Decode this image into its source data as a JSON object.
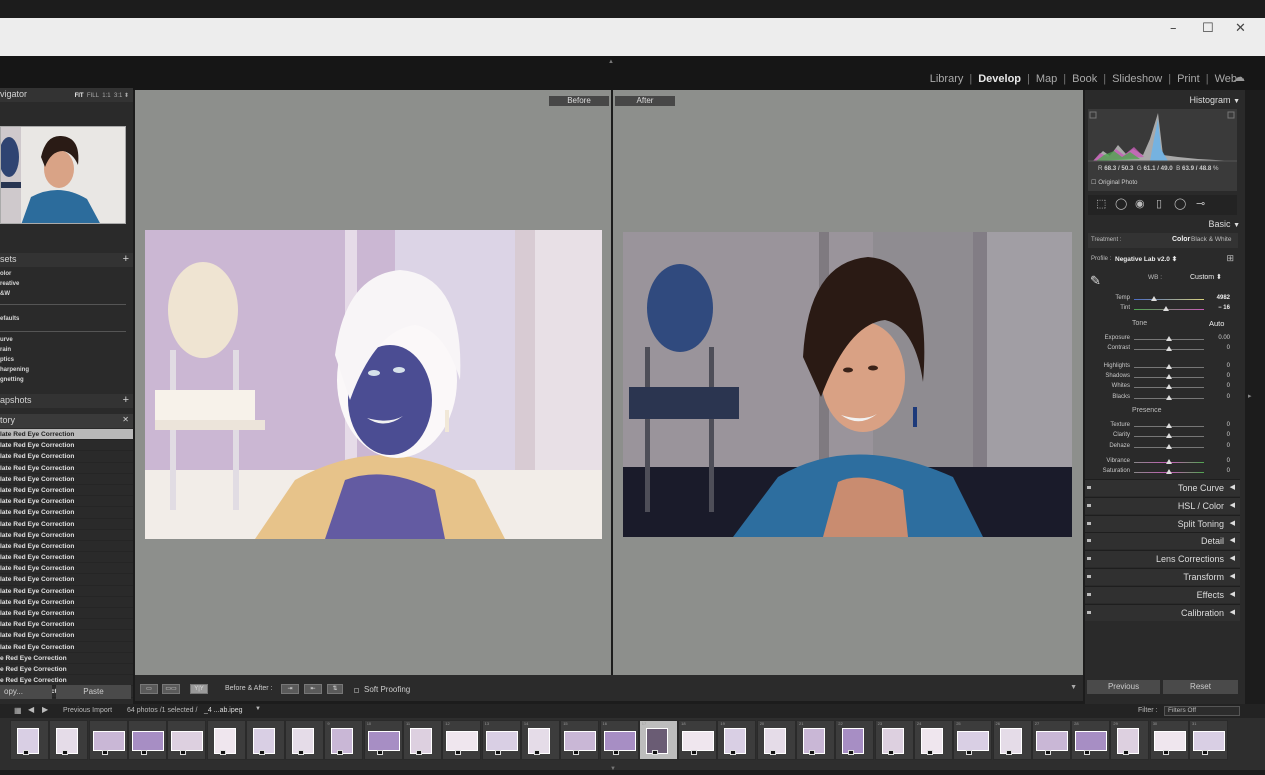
{
  "window": {
    "minimize_icon": "–",
    "maximize_icon": "☐",
    "close_icon": "✕"
  },
  "modules": [
    {
      "label": "Library",
      "active": false
    },
    {
      "label": "Develop",
      "active": true
    },
    {
      "label": "Map",
      "active": false
    },
    {
      "label": "Book",
      "active": false
    },
    {
      "label": "Slideshow",
      "active": false
    },
    {
      "label": "Print",
      "active": false
    },
    {
      "label": "Web",
      "active": false
    }
  ],
  "left": {
    "navigator": {
      "title": "vigator",
      "opt_fit": "FIT",
      "opt_fill": "FILL",
      "opt_1": "1:1",
      "opt_3": "3:1 ⬍"
    },
    "presets": {
      "title": "sets",
      "add": "+",
      "items": [
        "olor",
        "reative",
        "&W"
      ],
      "defaults": "efaults",
      "more": [
        "urve",
        "rain",
        "ptics",
        "harpening",
        "gnetting"
      ]
    },
    "snapshots": {
      "title": "apshots",
      "add": "+"
    },
    "history": {
      "title": "tory",
      "close": "✕",
      "items": [
        "late Red Eye Correction",
        "late Red Eye Correction",
        "late Red Eye Correction",
        "late Red Eye Correction",
        "late Red Eye Correction",
        "late Red Eye Correction",
        "late Red Eye Correction",
        "late Red Eye Correction",
        "late Red Eye Correction",
        "late Red Eye Correction",
        "late Red Eye Correction",
        "late Red Eye Correction",
        "late Red Eye Correction",
        "late Red Eye Correction",
        "late Red Eye Correction",
        "late Red Eye Correction",
        "late Red Eye Correction",
        "late Red Eye Correction",
        "late Red Eye Correction",
        "late Red Eye Correction",
        "e Red Eye Correction",
        "e Red Eye Correction",
        "e Red Eye Correction",
        "e Red Eye Correction"
      ]
    },
    "copy_label": "opy...",
    "paste_label": "Paste"
  },
  "center": {
    "before_label": "Before",
    "after_label": "After"
  },
  "toolbar": {
    "before_after_label": "Before & After :",
    "soft_proofing_label": "Soft Proofing"
  },
  "right": {
    "histogram": {
      "title": "Histogram",
      "r_label": "R",
      "r_val": "68.3 / 50.3",
      "g_label": "G",
      "g_val": "61.1 / 49.0",
      "b_label": "B",
      "b_val": "63.9 / 48.8",
      "pct": "%",
      "original_photo": "Original Photo"
    },
    "basic": {
      "title": "Basic",
      "treatment_label": "Treatment :",
      "color_label": "Color",
      "bw_label": "Black & White",
      "profile_label": "Profile :",
      "profile_value": "Negative Lab v2.0 ⬍",
      "wb_label": "WB :",
      "wb_value": "Custom ⬍",
      "tone_label": "Tone",
      "auto_label": "Auto",
      "presence_label": "Presence",
      "sliders": [
        {
          "label": "Temp",
          "value": "4982",
          "pos": 0.29
        },
        {
          "label": "Tint",
          "value": "− 16",
          "pos": 0.45
        },
        {
          "label": "Exposure",
          "value": "0.00",
          "pos": 0.5
        },
        {
          "label": "Contrast",
          "value": "0",
          "pos": 0.5
        },
        {
          "label": "Highlights",
          "value": "0",
          "pos": 0.5
        },
        {
          "label": "Shadows",
          "value": "0",
          "pos": 0.5
        },
        {
          "label": "Whites",
          "value": "0",
          "pos": 0.5
        },
        {
          "label": "Blacks",
          "value": "0",
          "pos": 0.5
        },
        {
          "label": "Texture",
          "value": "0",
          "pos": 0.5
        },
        {
          "label": "Clarity",
          "value": "0",
          "pos": 0.5
        },
        {
          "label": "Dehaze",
          "value": "0",
          "pos": 0.5
        },
        {
          "label": "Vibrance",
          "value": "0",
          "pos": 0.5
        },
        {
          "label": "Saturation",
          "value": "0",
          "pos": 0.5
        }
      ]
    },
    "sections": [
      {
        "name": "Tone Curve"
      },
      {
        "name": "HSL / Color"
      },
      {
        "name": "Split Toning"
      },
      {
        "name": "Detail"
      },
      {
        "name": "Lens Corrections"
      },
      {
        "name": "Transform"
      },
      {
        "name": "Effects"
      },
      {
        "name": "Calibration"
      }
    ],
    "previous_label": "Previous",
    "reset_label": "Reset"
  },
  "filmstrip": {
    "source_label": "Previous Import",
    "count_label": "64 photos /1 selected /",
    "file_label": "_4 ...ab.ipeg",
    "filter_label": "Filter :",
    "filter_value": "Filters Off",
    "numbers": [
      "",
      "",
      "",
      "",
      "",
      "",
      "",
      "",
      "9",
      "10",
      "11",
      "12",
      "13",
      "14",
      "15",
      "16",
      "17",
      "18",
      "19",
      "20",
      "21",
      "22",
      "23",
      "24",
      "25",
      "26",
      "27",
      "28",
      "29",
      "30",
      "31"
    ]
  },
  "colors": {
    "accent": "#e8e8e8",
    "panel": "#2a2a2a",
    "canvas": "#8d8f8c"
  }
}
